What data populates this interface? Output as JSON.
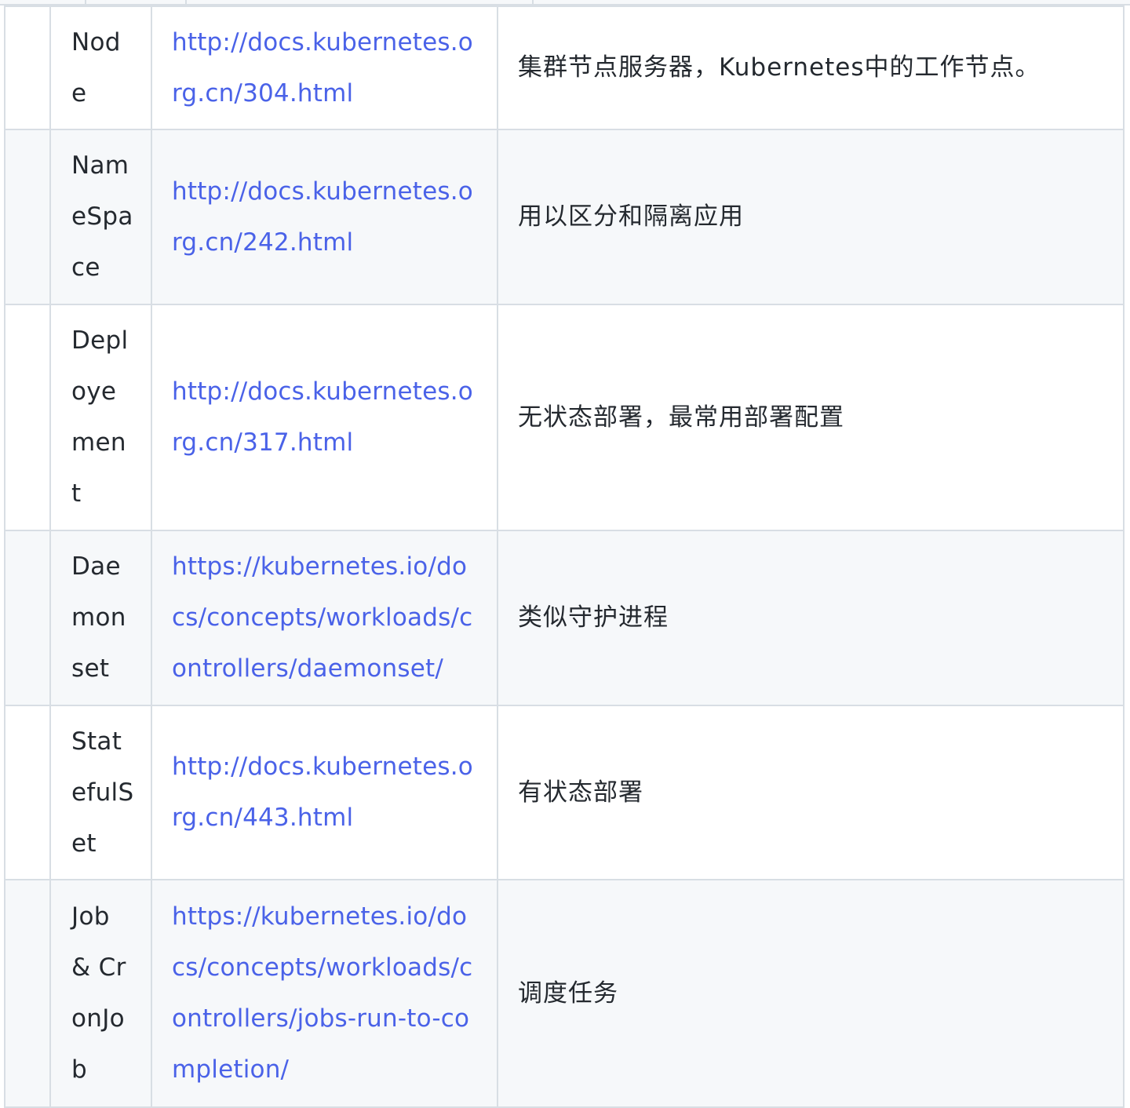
{
  "table": {
    "rows": [
      {
        "name": "Node",
        "link": "http://docs.kubernetes.org.cn/304.html",
        "desc": "集群节点服务器，Kubernetes中的工作节点。"
      },
      {
        "name": "NameSpace",
        "link": "http://docs.kubernetes.org.cn/242.html",
        "desc": "用以区分和隔离应用"
      },
      {
        "name": "Deployement",
        "link": "http://docs.kubernetes.org.cn/317.html",
        "desc": "无状态部署，最常用部署配置"
      },
      {
        "name": "Daemonset",
        "link": "https://kubernetes.io/docs/concepts/workloads/controllers/daemonset/",
        "desc": "类似守护进程"
      },
      {
        "name": "StatefulSet",
        "link": "http://docs.kubernetes.org.cn/443.html",
        "desc": "有状态部署"
      },
      {
        "name": "Job & CronJob",
        "link": "https://kubernetes.io/docs/concepts/workloads/controllers/jobs-run-to-completion/",
        "desc": "调度任务"
      }
    ]
  },
  "colors": {
    "link": "#4a62e8",
    "border": "#d8dee4",
    "stripe": "#f6f8fa",
    "text": "#24292f"
  }
}
